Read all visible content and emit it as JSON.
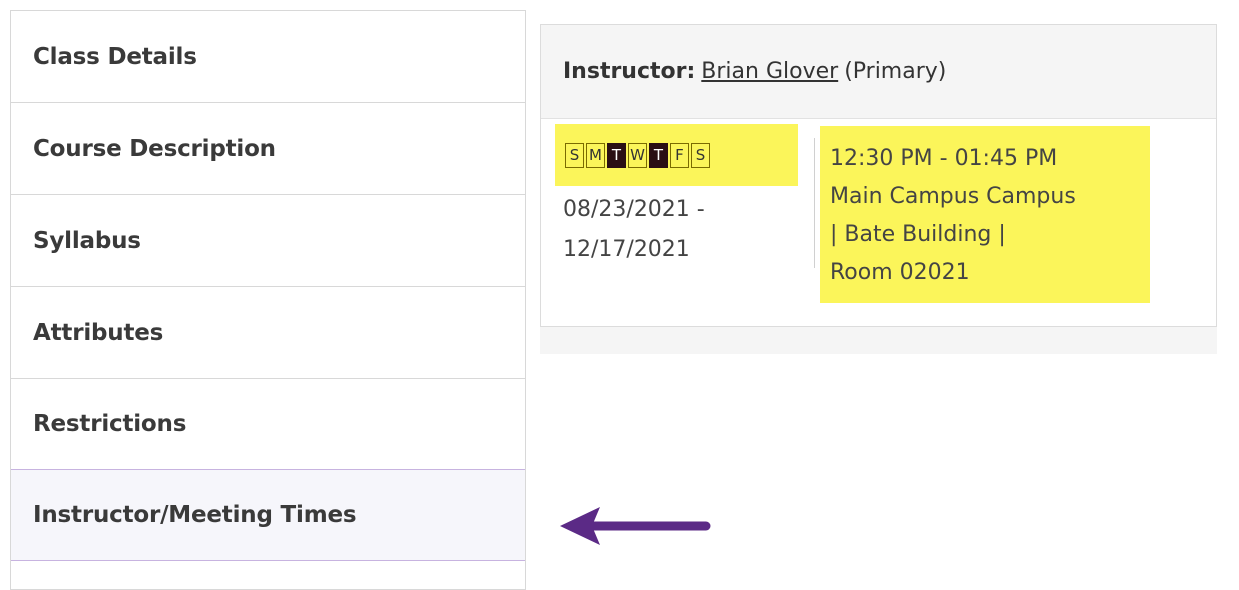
{
  "sidebar": {
    "items": [
      {
        "label": "Class Details"
      },
      {
        "label": "Course Description"
      },
      {
        "label": "Syllabus"
      },
      {
        "label": "Attributes"
      },
      {
        "label": "Restrictions"
      },
      {
        "label": "Instructor/Meeting Times",
        "active": true
      }
    ]
  },
  "instructor": {
    "label": "Instructor:",
    "name": "Brian Glover",
    "role": "(Primary)"
  },
  "meeting": {
    "days": [
      {
        "letter": "S",
        "active": false
      },
      {
        "letter": "M",
        "active": false
      },
      {
        "letter": "T",
        "active": true
      },
      {
        "letter": "W",
        "active": false
      },
      {
        "letter": "T",
        "active": true
      },
      {
        "letter": "F",
        "active": false
      },
      {
        "letter": "S",
        "active": false
      }
    ],
    "start_date": "08/23/2021 -",
    "end_date": "12/17/2021",
    "time": "12:30 PM - 01:45 PM",
    "location_line1": "Main Campus Campus",
    "location_line2": "| Bate Building |",
    "location_line3": "Room 02021"
  },
  "colors": {
    "highlight": "#fbf55a",
    "active_day": "#2a0f14",
    "arrow": "#5b2a86"
  },
  "icons": {
    "arrow": "left-arrow-icon"
  }
}
